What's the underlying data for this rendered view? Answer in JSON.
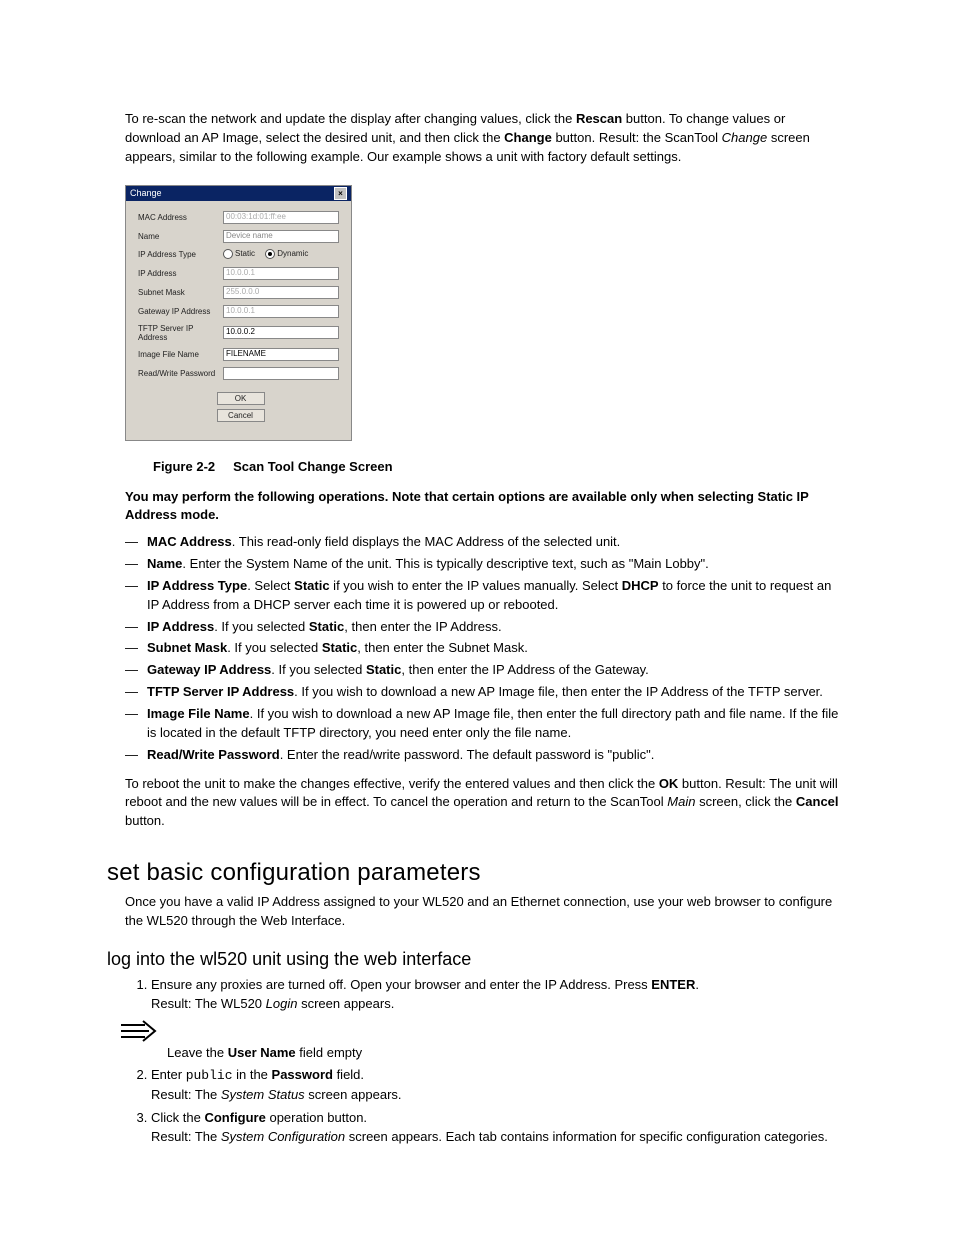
{
  "intro": {
    "pre_rescan": "To re-scan the network and update the display after changing values, click the ",
    "rescan": "Rescan",
    "post_rescan": " button. To change values or download an AP Image, select the desired unit, and then click the ",
    "change": "Change",
    "post_change": " button. Result: the ScanTool ",
    "italic": "Change",
    "post_italic": " screen appears, similar to the following example. Our example shows a unit with factory default settings."
  },
  "dialog": {
    "title": "Change",
    "rows": {
      "mac_label": "MAC Address",
      "mac_value": "00:03:1d:01:ff:ee",
      "name_label": "Name",
      "name_value": "Device name",
      "iptype_label": "IP Address Type",
      "iptype_static": "Static",
      "iptype_dynamic": "Dynamic",
      "ip_label": "IP Address",
      "ip_value": "10.0.0.1",
      "subnet_label": "Subnet Mask",
      "subnet_value": "255.0.0.0",
      "gateway_label": "Gateway IP Address",
      "gateway_value": "10.0.0.1",
      "tftp_label": "TFTP Server IP Address",
      "tftp_value": "10.0.0.2",
      "image_label": "Image File Name",
      "image_value": "FILENAME",
      "pw_label": "Read/Write Password",
      "pw_value": ""
    },
    "ok": "OK",
    "cancel": "Cancel"
  },
  "figure": {
    "num": "Figure 2-2",
    "title": "Scan Tool Change Screen"
  },
  "instr_lead": "You may perform the following operations. Note that certain options are available only when selecting Static IP Address mode.",
  "bullets": [
    {
      "b": "MAC Address",
      "t": ". This read-only field displays the MAC Address of the selected unit."
    },
    {
      "b": "Name",
      "t": ". Enter the System Name of the unit. This is typically descriptive text, such as \"Main Lobby\"."
    },
    {
      "b": "IP Address Type",
      "pre": ". Select ",
      "b2": "Static",
      "mid": " if you wish to enter the IP values manually. Select ",
      "b3": "DHCP",
      "post": " to force the unit to request an IP Address from a DHCP server each time it is powered up or rebooted."
    },
    {
      "b": "IP Address",
      "pre": ". If you selected ",
      "b2": "Static",
      "post": ", then enter the IP Address."
    },
    {
      "b": "Subnet Mask",
      "pre": ". If you selected ",
      "b2": "Static",
      "post": ", then enter the Subnet Mask."
    },
    {
      "b": "Gateway IP Address",
      "pre": ". If you selected ",
      "b2": "Static",
      "post": ", then enter the IP Address of the Gateway."
    },
    {
      "b": "TFTP Server IP Address",
      "t": ". If you wish to download a new AP Image file, then enter the IP Address of the TFTP server."
    },
    {
      "b": "Image File Name",
      "t": ". If you wish to download a new AP Image file, then enter the full directory path and file name. If the file is located in the default TFTP directory, you need enter only the file name."
    },
    {
      "b": "Read/Write Password",
      "t": ". Enter the read/write password. The default password is \"public\"."
    }
  ],
  "reboot": {
    "pre": "To reboot the unit to make the changes effective, verify the entered values and then click the ",
    "ok": "OK",
    "mid": " button. Result: The unit will reboot and the new values will be in effect. To cancel the operation and return to the ScanTool ",
    "italic": "Main",
    "mid2": " screen, click the ",
    "cancel": "Cancel",
    "post": " button."
  },
  "h1": "set basic configuration parameters",
  "h1_body": "Once you have a valid IP Address assigned to your WL520 and an Ethernet connection, use your web browser to configure the WL520 through the Web Interface.",
  "h2": "log into the wl520 unit using the web interface",
  "steps": {
    "s1a": "Ensure any proxies are turned off. Open your browser and enter the IP Address. Press ",
    "s1_enter": "ENTER",
    "s1b": ".",
    "s1_result_pre": "Result: The WL520 ",
    "s1_result_i": "Login",
    "s1_result_post": " screen appears.",
    "arrow_text_pre": "Leave the ",
    "arrow_text_b": "User Name",
    "arrow_text_post": " field empty",
    "s2a": "Enter ",
    "s2_mono": "public",
    "s2b": " in the ",
    "s2_b": "Password",
    "s2c": " field.",
    "s2_result_pre": "Result: The ",
    "s2_result_i": "System Status",
    "s2_result_post": " screen appears.",
    "s3a": "Click the ",
    "s3_b": "Configure",
    "s3b": " operation button.",
    "s3_result_pre": "Result: The ",
    "s3_result_i": "System Configuration",
    "s3_result_post": " screen appears. Each tab contains information for specific configuration categories."
  }
}
